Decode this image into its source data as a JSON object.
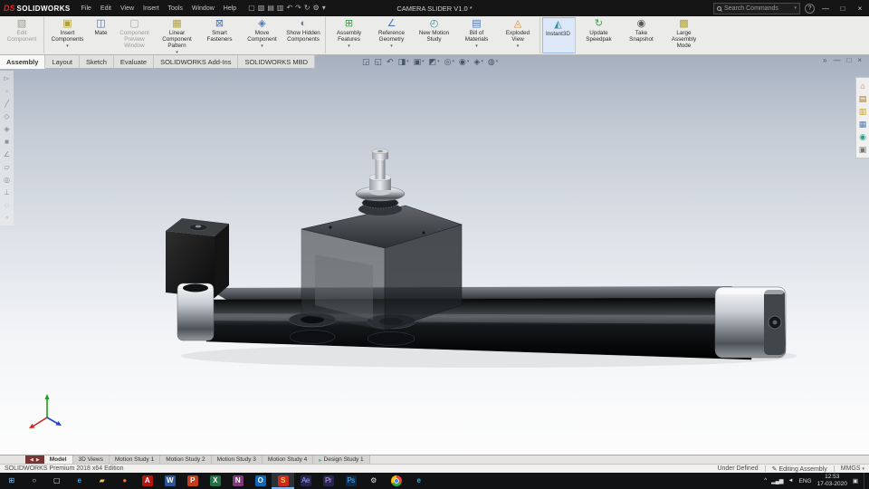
{
  "title_bar": {
    "logo_mark": "DS",
    "logo_text": "SOLIDWORKS",
    "menus": [
      "File",
      "Edit",
      "View",
      "Insert",
      "Tools",
      "Window",
      "Help"
    ],
    "quick_icons": [
      {
        "name": "new-document-icon",
        "glyph": "▢"
      },
      {
        "name": "open-document-icon",
        "glyph": "▧"
      },
      {
        "name": "save-icon",
        "glyph": "▤"
      },
      {
        "name": "print-icon",
        "glyph": "▥"
      },
      {
        "name": "undo-icon",
        "glyph": "↶"
      },
      {
        "name": "redo-icon",
        "glyph": "↷"
      },
      {
        "name": "rebuild-icon",
        "glyph": "↻"
      },
      {
        "name": "options-gear-icon",
        "glyph": "⚙"
      },
      {
        "name": "toolbar-dropdown-icon",
        "glyph": "▾"
      }
    ],
    "document_title": "CAMERA SLIDER V1.0 *",
    "search_placeholder": "Search Commands",
    "help_label": "?"
  },
  "ribbon": {
    "buttons": [
      {
        "name": "edit-component-button",
        "label": "Edit Component",
        "glyph": "▧",
        "color": "#9a9a92",
        "disabled": true,
        "sep_after": true
      },
      {
        "name": "insert-components-button",
        "label": "Insert Components",
        "glyph": "▣",
        "color": "#b0a23c",
        "dropdown": true
      },
      {
        "name": "mate-button",
        "label": "Mate",
        "glyph": "◫",
        "color": "#4a77c0"
      },
      {
        "name": "component-preview-window-button",
        "label": "Component Preview Window",
        "glyph": "▢",
        "color": "#a8a8a0",
        "disabled": true
      },
      {
        "name": "linear-component-pattern-button",
        "label": "Linear Component Pattern",
        "glyph": "▦",
        "color": "#b0a23c",
        "dropdown": true
      },
      {
        "name": "smart-fasteners-button",
        "label": "Smart Fasteners",
        "glyph": "⊠",
        "color": "#4a77c0"
      },
      {
        "name": "move-component-button",
        "label": "Move Component",
        "glyph": "◈",
        "color": "#4a77c0",
        "dropdown": true
      },
      {
        "name": "show-hidden-components-button",
        "label": "Show Hidden Components",
        "glyph": "◐",
        "color": "#6a7a8a",
        "sep_after": true
      },
      {
        "name": "assembly-features-button",
        "label": "Assembly Features",
        "glyph": "⊞",
        "color": "#3f9b48",
        "dropdown": true
      },
      {
        "name": "reference-geometry-button",
        "label": "Reference Geometry",
        "glyph": "∠",
        "color": "#4a77c0",
        "dropdown": true
      },
      {
        "name": "new-motion-study-button",
        "label": "New Motion Study",
        "glyph": "◴",
        "color": "#3a8fa0"
      },
      {
        "name": "bill-of-materials-button",
        "label": "Bill of Materials",
        "glyph": "▤",
        "color": "#4a77c0",
        "dropdown": true
      },
      {
        "name": "exploded-view-button",
        "label": "Exploded View",
        "glyph": "◬",
        "color": "#d78b2a",
        "dropdown": true,
        "sep_after": true
      },
      {
        "name": "instant3d-button",
        "label": "Instant3D",
        "glyph": "◭",
        "color": "#3a8fa0",
        "active": true,
        "sep_after": true
      },
      {
        "name": "update-speedpak-button",
        "label": "Update Speedpak",
        "glyph": "↻",
        "color": "#3f9b48"
      },
      {
        "name": "take-snapshot-button",
        "label": "Take Snapshot",
        "glyph": "◉",
        "color": "#555555"
      },
      {
        "name": "large-assembly-mode-button",
        "label": "Large Assembly Mode",
        "glyph": "▩",
        "color": "#b0a23c"
      }
    ]
  },
  "command_tabs": [
    {
      "label": "Assembly",
      "active": true
    },
    {
      "label": "Layout"
    },
    {
      "label": "Sketch"
    },
    {
      "label": "Evaluate"
    },
    {
      "label": "SOLIDWORKS Add-Ins"
    },
    {
      "label": "SOLIDWORKS MBD"
    }
  ],
  "view_toolbar": [
    {
      "name": "zoom-to-fit-icon",
      "glyph": "◲"
    },
    {
      "name": "zoom-to-area-icon",
      "glyph": "◱"
    },
    {
      "name": "previous-view-icon",
      "glyph": "↶"
    },
    {
      "name": "section-view-icon",
      "glyph": "◨",
      "dropdown": true
    },
    {
      "name": "view-orientation-icon",
      "glyph": "▣",
      "dropdown": true
    },
    {
      "name": "display-style-icon",
      "glyph": "◩",
      "dropdown": true
    },
    {
      "name": "hide-show-items-icon",
      "glyph": "◎",
      "dropdown": true
    },
    {
      "name": "edit-appearance-icon",
      "glyph": "◉",
      "dropdown": true
    },
    {
      "name": "apply-scene-icon",
      "glyph": "◈",
      "dropdown": true
    },
    {
      "name": "view-settings-icon",
      "glyph": "◍",
      "dropdown": true
    }
  ],
  "doc_controls": [
    {
      "name": "expand-flyout-icon",
      "glyph": "»"
    },
    {
      "name": "minimize-document-icon",
      "glyph": "—"
    },
    {
      "name": "restore-document-icon",
      "glyph": "□"
    },
    {
      "name": "close-document-icon",
      "glyph": "×"
    }
  ],
  "left_toolbar": [
    {
      "name": "clear-selection-filters-icon",
      "glyph": "▻"
    },
    {
      "name": "filter-vertices-icon",
      "glyph": "◦"
    },
    {
      "name": "filter-edges-icon",
      "glyph": "╱"
    },
    {
      "name": "filter-faces-icon",
      "glyph": "◇"
    },
    {
      "name": "filter-surface-bodies-icon",
      "glyph": "◈"
    },
    {
      "name": "filter-solid-bodies-icon",
      "glyph": "■"
    },
    {
      "name": "filter-axes-icon",
      "glyph": "∠"
    },
    {
      "name": "filter-planes-icon",
      "glyph": "▱"
    },
    {
      "name": "filter-origins-icon",
      "glyph": "◎"
    },
    {
      "name": "filter-coordinate-systems-icon",
      "glyph": "⊥"
    },
    {
      "name": "filter-sketches-icon",
      "glyph": "◌"
    },
    {
      "name": "filter-midpoints-icon",
      "glyph": "▫"
    }
  ],
  "task_pane": [
    {
      "name": "solidworks-resources-icon",
      "glyph": "⌂",
      "color": "#d8821e"
    },
    {
      "name": "design-library-icon",
      "glyph": "▤",
      "color": "#a8742c"
    },
    {
      "name": "file-explorer-icon",
      "glyph": "▥",
      "color": "#c8a22c"
    },
    {
      "name": "view-palette-icon",
      "glyph": "▦",
      "color": "#5a7ca8"
    },
    {
      "name": "appearances-scenes-icon",
      "glyph": "◉",
      "color": "#3a9a8a"
    },
    {
      "name": "custom-properties-icon",
      "glyph": "▣",
      "color": "#787878"
    }
  ],
  "model_tabs": {
    "nav": [
      {
        "name": "scroll-tabs-left-icon",
        "glyph": "◀"
      },
      {
        "name": "scroll-tabs-right-icon",
        "glyph": "▶"
      }
    ],
    "tabs": [
      {
        "label": "Model",
        "active": true
      },
      {
        "label": "3D Views"
      },
      {
        "label": "Motion Study 1"
      },
      {
        "label": "Motion Study 2"
      },
      {
        "label": "Motion Study 3"
      },
      {
        "label": "Motion Study 4"
      },
      {
        "label": "Design Study 1",
        "icon": "▸"
      }
    ]
  },
  "status_bar": {
    "product": "SOLIDWORKS Premium 2018 x64 Edition",
    "constraint_status": "Under Defined",
    "edit_icon": "✎",
    "mode": "Editing Assembly",
    "units": "MMGS",
    "units_dropdown": "▾"
  },
  "taskbar": {
    "icons": [
      {
        "name": "start-button",
        "glyph": "⊞",
        "fg": "#7fc0f8"
      },
      {
        "name": "search-button",
        "glyph": "○",
        "fg": "#e0e0e0"
      },
      {
        "name": "task-view-button",
        "glyph": "▢",
        "fg": "#e0e0e0"
      },
      {
        "name": "edge-browser-icon",
        "glyph": "e",
        "fg": "#46a3e8",
        "bold": true
      },
      {
        "name": "file-explorer-icon",
        "glyph": "▰",
        "fg": "#f2c14e"
      },
      {
        "name": "firefox-icon",
        "glyph": "●",
        "fg": "#f26f21"
      },
      {
        "name": "acrobat-reader-icon",
        "glyph": "A",
        "fg": "#ffffff",
        "bg": "#b3150f",
        "bold": true
      },
      {
        "name": "word-icon",
        "glyph": "W",
        "fg": "#ffffff",
        "bg": "#2b579a",
        "bold": true
      },
      {
        "name": "powerpoint-icon",
        "glyph": "P",
        "fg": "#ffffff",
        "bg": "#c43e1c",
        "bold": true
      },
      {
        "name": "excel-icon",
        "glyph": "X",
        "fg": "#ffffff",
        "bg": "#217346",
        "bold": true
      },
      {
        "name": "onenote-icon",
        "glyph": "N",
        "fg": "#ffffff",
        "bg": "#80397b",
        "bold": true
      },
      {
        "name": "outlook-icon",
        "glyph": "O",
        "fg": "#ffffff",
        "bg": "#1066b8",
        "bold": true
      },
      {
        "name": "solidworks-taskbar-icon",
        "glyph": "S",
        "fg": "#ffd94a",
        "bg": "#cc2a20",
        "bold": true,
        "active": true
      },
      {
        "name": "after-effects-icon",
        "glyph": "Ae",
        "fg": "#9aa0f5",
        "bg": "#26264f"
      },
      {
        "name": "premiere-icon",
        "glyph": "Pr",
        "fg": "#cf9ef5",
        "bg": "#26264f"
      },
      {
        "name": "photoshop-icon",
        "glyph": "Ps",
        "fg": "#55b1f5",
        "bg": "#0c2c4a"
      },
      {
        "name": "settings-icon",
        "glyph": "⚙",
        "fg": "#e0e0e0"
      },
      {
        "name": "chrome-icon",
        "bg": "radial-gradient(circle, #4285f4 0 25%, #ffffff 25% 33%, rgba(0,0,0,0) 33%), conic-gradient(#ea4335 0 120deg, #34a853 120deg 240deg, #fbbc05 240deg 360deg)",
        "round": true
      },
      {
        "name": "internet-explorer-icon",
        "glyph": "e",
        "fg": "#35b2e8",
        "bold": true
      }
    ],
    "tray": {
      "icons": [
        {
          "name": "hidden-icons-chevron",
          "glyph": "^"
        },
        {
          "name": "network-signal-icon",
          "glyph": "▂▄▆"
        },
        {
          "name": "volume-icon",
          "glyph": "◄"
        }
      ],
      "language": "ENG",
      "time": "12:53",
      "date": "17-03-2020",
      "action_center": {
        "glyph": "▣"
      }
    }
  }
}
